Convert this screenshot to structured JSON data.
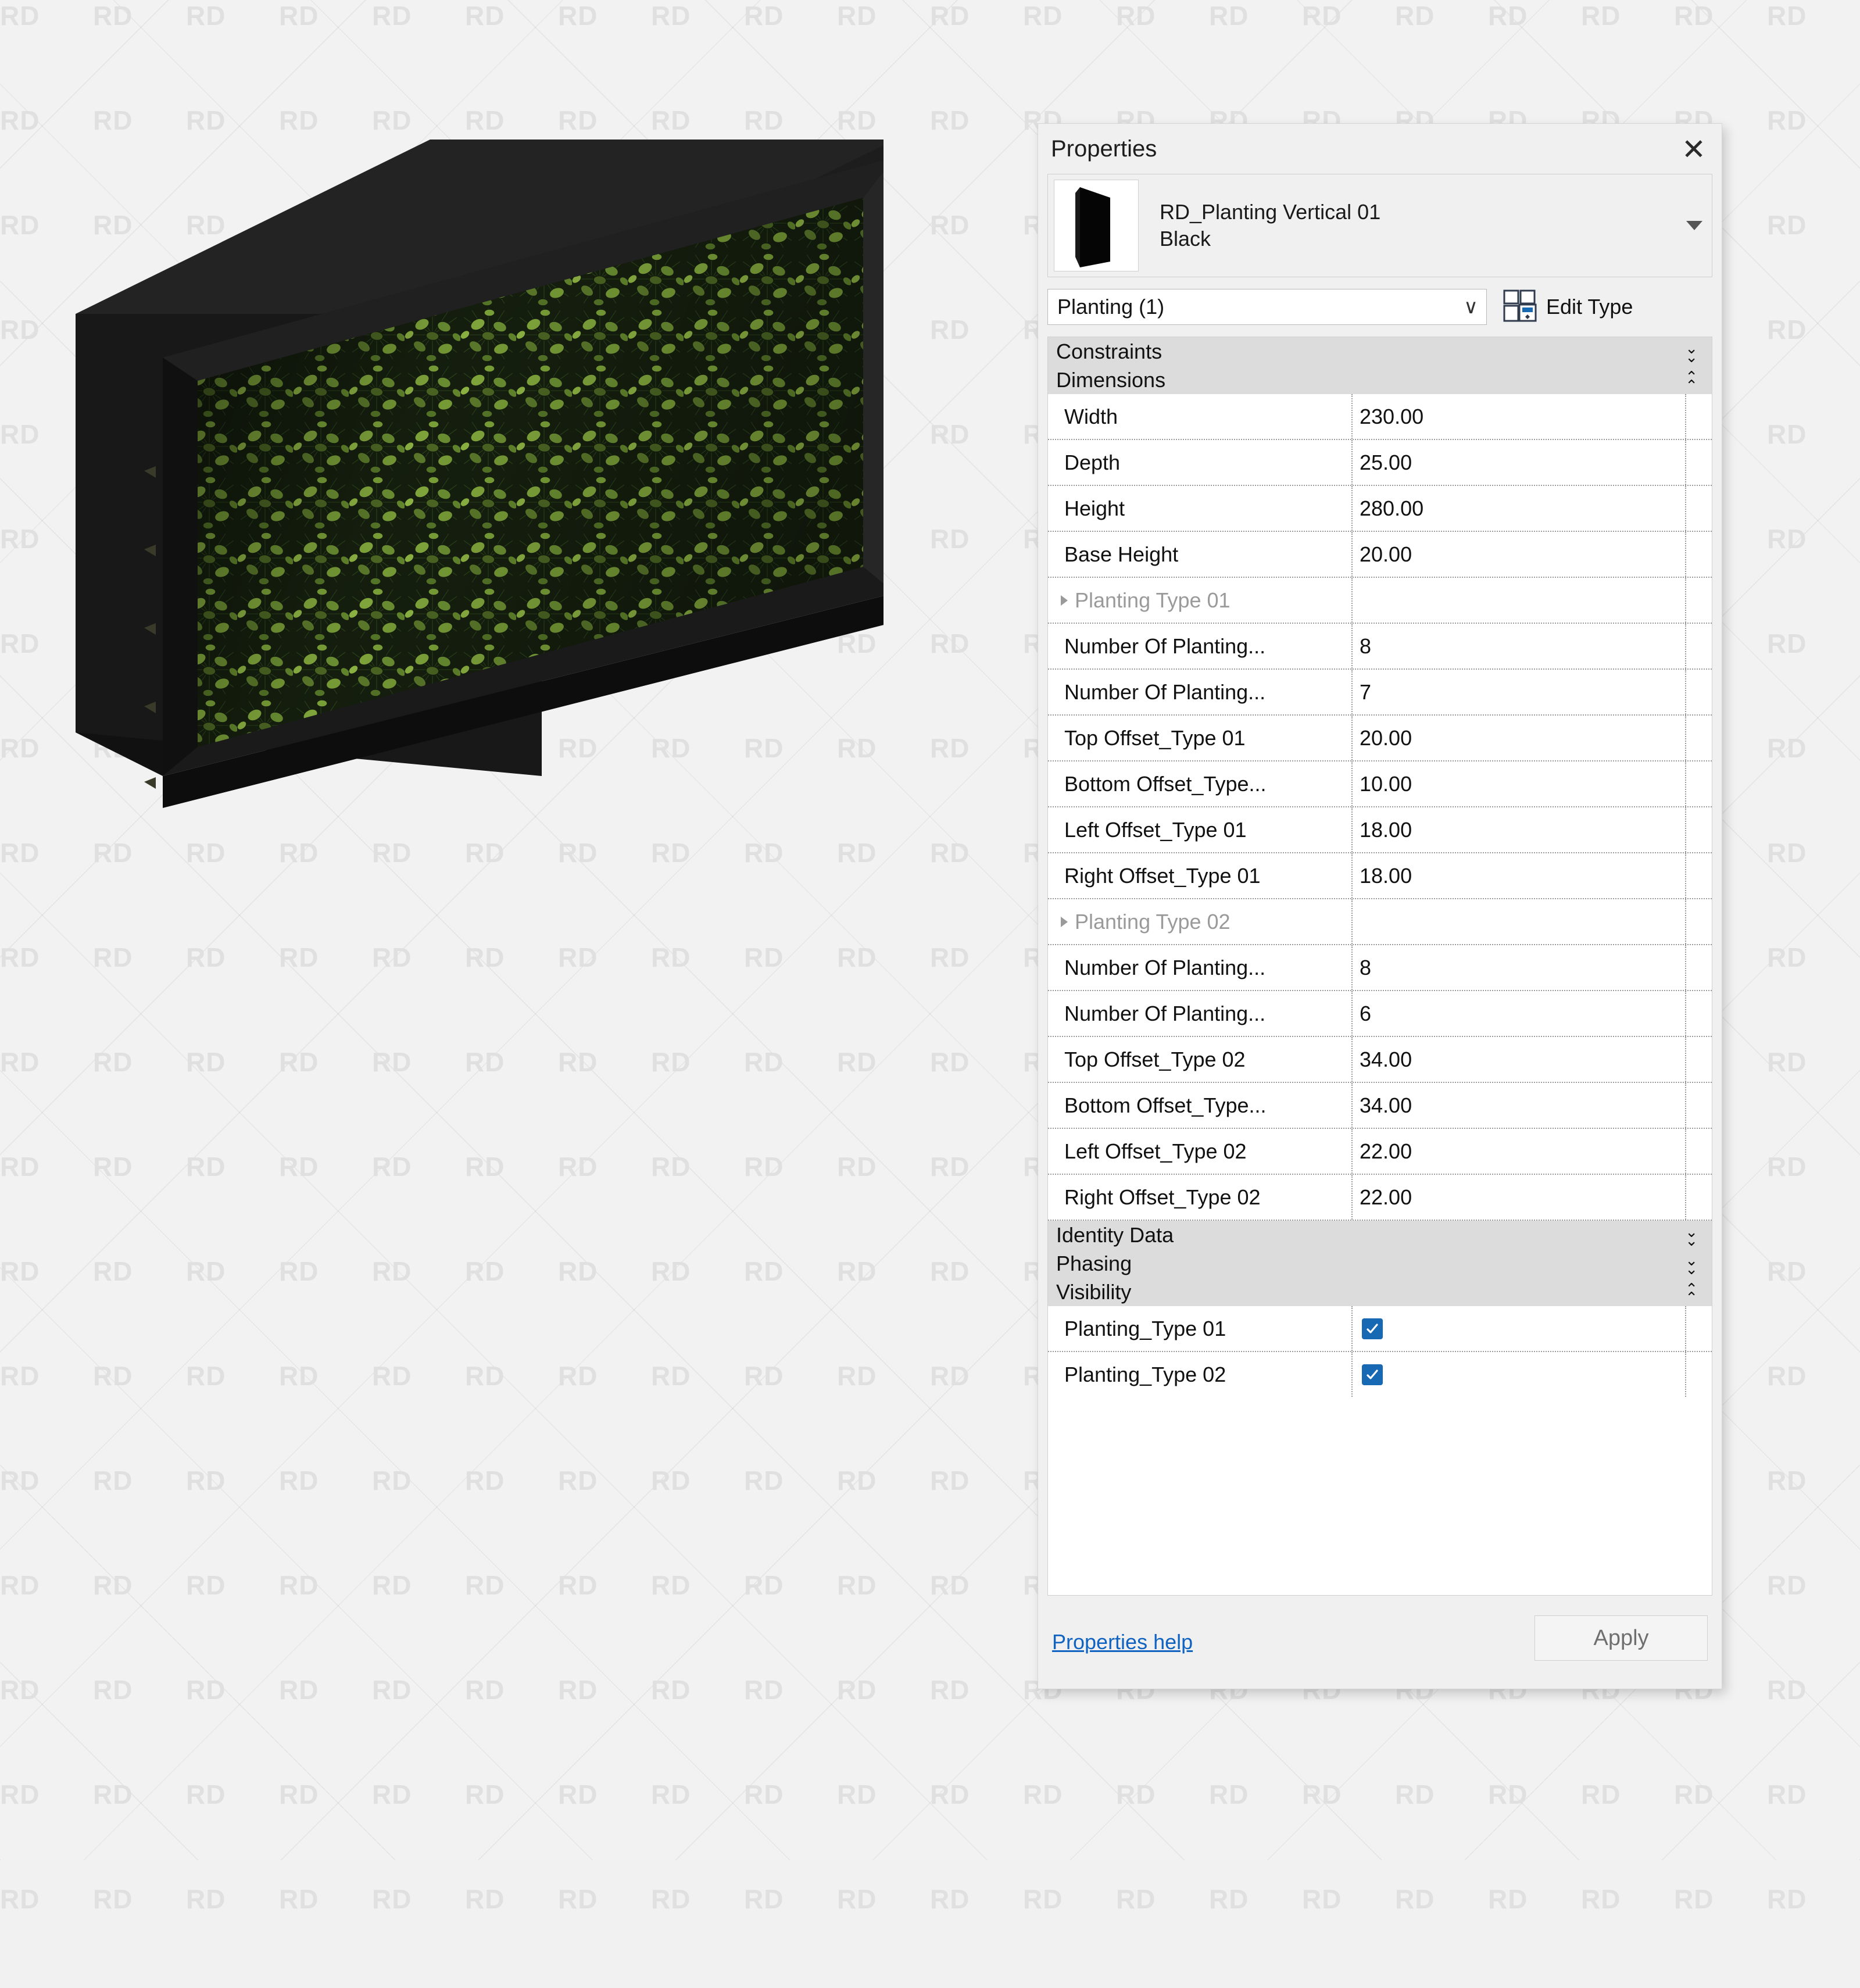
{
  "background": {
    "watermark_text": "RD",
    "page_bg": "#f2f2f2"
  },
  "viewport": {
    "model_name": "RD_Planting Vertical 01 Black",
    "model_description": "Isometric 3D view of a black-framed vertical planting wall filled with green foliage"
  },
  "palette": {
    "title": "Properties",
    "close_label": "✕",
    "type_header": {
      "family_name": "RD_Planting Vertical 01",
      "type_name": "Black",
      "dropdown_caret": "▼",
      "thumbnail_name": "planting-panel-thumbnail"
    },
    "category_combo": {
      "value": "Planting (1)",
      "chevron": "∨"
    },
    "edit_type": {
      "label": "Edit Type"
    },
    "groups": [
      {
        "name": "Constraints",
        "state": "collapsed",
        "arrow": "»",
        "rows": []
      },
      {
        "name": "Dimensions",
        "state": "expanded",
        "arrow": "«",
        "rows": [
          {
            "label": "Width",
            "value": "230.00",
            "kind": "value"
          },
          {
            "label": "Depth",
            "value": "25.00",
            "kind": "value"
          },
          {
            "label": "Height",
            "value": "280.00",
            "kind": "value"
          },
          {
            "label": "Base Height",
            "value": "20.00",
            "kind": "value"
          },
          {
            "label": "Planting Type 01",
            "value": "",
            "kind": "subheader"
          },
          {
            "label": "Number Of Planting...",
            "value": "8",
            "kind": "value"
          },
          {
            "label": "Number Of Planting...",
            "value": "7",
            "kind": "value"
          },
          {
            "label": "Top Offset_Type 01",
            "value": "20.00",
            "kind": "value"
          },
          {
            "label": "Bottom Offset_Type...",
            "value": "10.00",
            "kind": "value"
          },
          {
            "label": "Left Offset_Type 01",
            "value": "18.00",
            "kind": "value"
          },
          {
            "label": "Right Offset_Type 01",
            "value": "18.00",
            "kind": "value"
          },
          {
            "label": "Planting Type 02",
            "value": "",
            "kind": "subheader"
          },
          {
            "label": "Number Of Planting...",
            "value": "8",
            "kind": "value"
          },
          {
            "label": "Number Of Planting...",
            "value": "6",
            "kind": "value"
          },
          {
            "label": "Top Offset_Type 02",
            "value": "34.00",
            "kind": "value"
          },
          {
            "label": "Bottom Offset_Type...",
            "value": "34.00",
            "kind": "value"
          },
          {
            "label": "Left Offset_Type 02",
            "value": "22.00",
            "kind": "value"
          },
          {
            "label": "Right Offset_Type 02",
            "value": "22.00",
            "kind": "value"
          }
        ]
      },
      {
        "name": "Identity Data",
        "state": "collapsed",
        "arrow": "»",
        "rows": []
      },
      {
        "name": "Phasing",
        "state": "collapsed",
        "arrow": "»",
        "rows": []
      },
      {
        "name": "Visibility",
        "state": "expanded",
        "arrow": "«",
        "rows": [
          {
            "label": "Planting_Type 01",
            "value": "",
            "kind": "checkbox",
            "checked": true
          },
          {
            "label": "Planting_Type 02",
            "value": "",
            "kind": "checkbox",
            "checked": true
          }
        ]
      }
    ],
    "footer": {
      "help_link": "Properties help",
      "apply_label": "Apply"
    },
    "colors": {
      "accent_blue": "#1769b3",
      "link_blue": "#1063c0",
      "group_header_bg": "#dcdcdc",
      "panel_bg": "#f0f0f0"
    }
  }
}
